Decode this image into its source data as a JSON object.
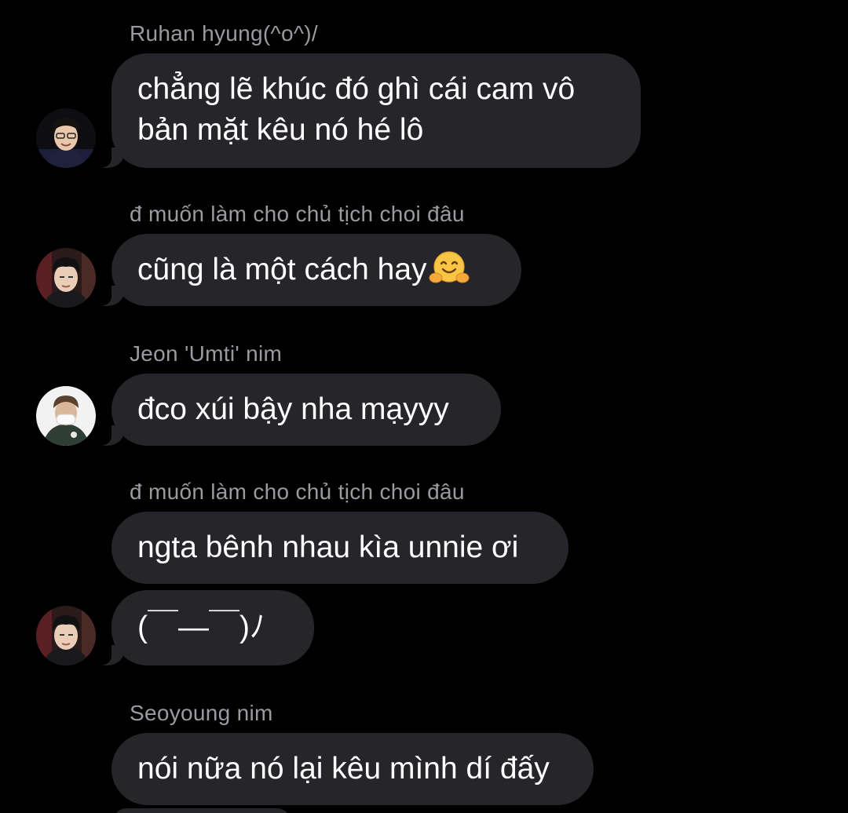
{
  "messages": [
    {
      "sender": "Ruhan hyung(^o^)/",
      "text_lines": [
        "chẳng lẽ khúc đó ghì cái cam vô",
        "bản mặt kêu nó hé lô"
      ],
      "avatar": "avatar-ruhan"
    },
    {
      "sender": "đ muốn làm cho chủ tịch choi đâu",
      "text": "cũng là một cách hay",
      "emoji": "hugging-face-icon",
      "avatar": "avatar-chu-tich"
    },
    {
      "sender": "Jeon 'Umti' nim",
      "text": "đco xúi bậy nha mạyyy",
      "avatar": "avatar-umti"
    },
    {
      "sender": "đ muốn làm cho chủ tịch choi đâu",
      "text": "ngta bênh nhau kìa unnie ơi"
    },
    {
      "text": "(￣—￣)ﾉ",
      "avatar": "avatar-chu-tich"
    },
    {
      "sender": "Seoyoung nim",
      "text": "nói nữa nó lại kêu mình dí đấy"
    }
  ],
  "colors": {
    "background": "#000000",
    "bubble": "#26252a",
    "sender_text": "#9a9aa0",
    "message_text": "#ffffff"
  }
}
